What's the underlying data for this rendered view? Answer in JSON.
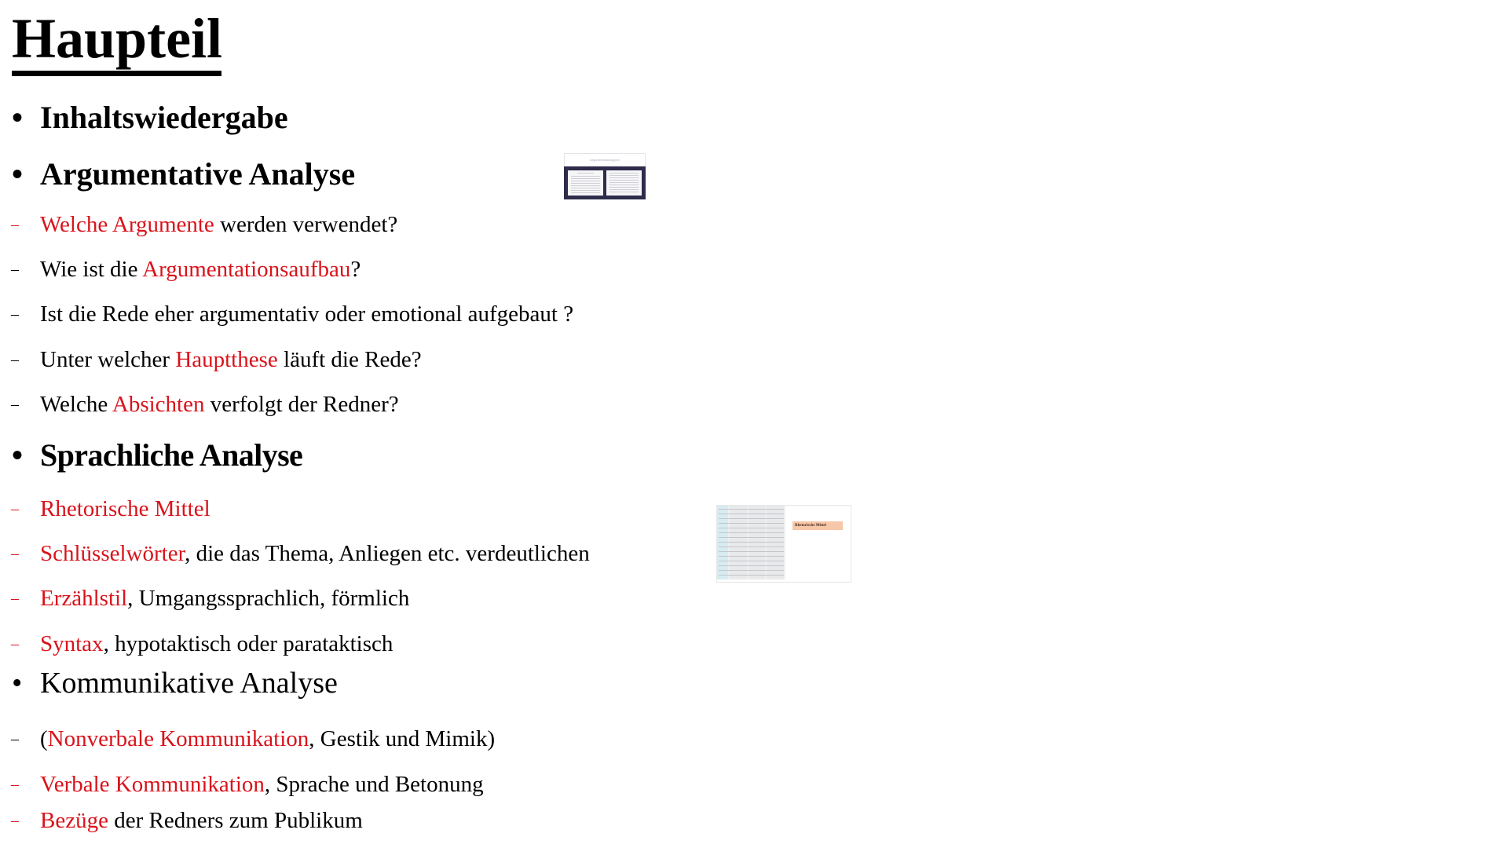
{
  "title": "Haupteil",
  "colors": {
    "accent_red": "#d9131b",
    "text": "#000000"
  },
  "sections": [
    {
      "heading": "Inhaltswiedergabe",
      "items": []
    },
    {
      "heading": "Argumentative Analyse",
      "items": [
        {
          "parts": [
            "Welche Argumente",
            " werden verwendet?"
          ]
        },
        {
          "parts": [
            "Wie ist die ",
            "Argumentationsaufbau",
            "?"
          ]
        },
        {
          "parts": [
            "Ist die Rede eher argumentativ oder emotional aufgebaut ?"
          ]
        },
        {
          "parts": [
            "Unter welcher ",
            "Hauptthese",
            " läuft die Rede?"
          ]
        },
        {
          "parts": [
            "Welche ",
            "Absichten",
            " verfolgt der Redner?"
          ]
        }
      ]
    },
    {
      "heading": "Sprachliche Analyse",
      "items": [
        {
          "parts": [
            "Rhetorische Mittel"
          ]
        },
        {
          "parts": [
            "Schlüsselwörter",
            ", die das Thema, Anliegen etc. verdeutlichen"
          ]
        },
        {
          "parts": [
            "Erzählstil",
            ", Umgangssprachlich, förmlich"
          ]
        },
        {
          "parts": [
            "Syntax",
            ", hypotaktisch oder parataktisch"
          ]
        }
      ]
    },
    {
      "heading": "Kommunikative Analyse",
      "items": [
        {
          "parts": [
            "(",
            "Nonverbale Kommunikation",
            ", Gestik und Mimik)"
          ]
        },
        {
          "parts": [
            "Verbale Kommunikation",
            ", Sprache und Betonung"
          ]
        },
        {
          "parts": [
            "Bezüge",
            " der Redners zum Publikum"
          ]
        }
      ]
    }
  ],
  "bullet_glyph": "•",
  "dash_glyph": "–",
  "thumbnails": {
    "argumentation": {
      "header": "Argumentationstypen"
    },
    "rhetorik": {
      "tag": "Rhetorische Mittel"
    }
  }
}
